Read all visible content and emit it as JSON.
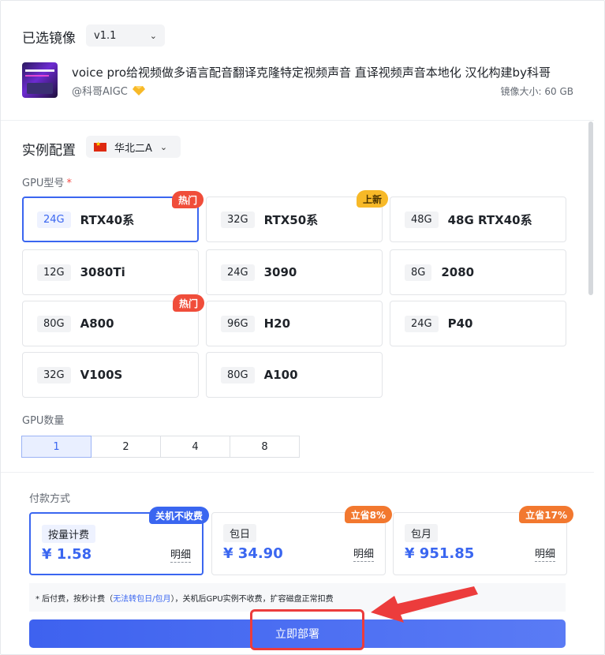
{
  "image_section": {
    "title": "已选镜像",
    "version": "v1.1",
    "image_title": "voice pro给视频做多语言配音翻译克隆特定视频声音 直译视频声音本地化 汉化构建by科哥",
    "author": "@科哥AIGC",
    "size": "镜像大小: 60 GB"
  },
  "config_section": {
    "title": "实例配置",
    "region": "华北二A",
    "gpu_model_label": "GPU型号",
    "required_mark": "*",
    "gpus": [
      {
        "mem": "24G",
        "name": "RTX40系",
        "badge": "热门"
      },
      {
        "mem": "32G",
        "name": "RTX50系",
        "badge": "上新"
      },
      {
        "mem": "48G",
        "name": "48G RTX40系",
        "badge": ""
      },
      {
        "mem": "12G",
        "name": "3080Ti",
        "badge": ""
      },
      {
        "mem": "24G",
        "name": "3090",
        "badge": ""
      },
      {
        "mem": "8G",
        "name": "2080",
        "badge": ""
      },
      {
        "mem": "80G",
        "name": "A800",
        "badge": "热门"
      },
      {
        "mem": "96G",
        "name": "H20",
        "badge": ""
      },
      {
        "mem": "24G",
        "name": "P40",
        "badge": ""
      },
      {
        "mem": "32G",
        "name": "V100S",
        "badge": ""
      },
      {
        "mem": "80G",
        "name": "A100",
        "badge": ""
      }
    ],
    "gpu_count_label": "GPU数量",
    "gpu_counts": [
      "1",
      "2",
      "4",
      "8"
    ]
  },
  "payment_section": {
    "title": "付款方式",
    "options": [
      {
        "mode": "按量计费",
        "price": "¥ 1.58",
        "detail": "明细",
        "badge": "关机不收费"
      },
      {
        "mode": "包日",
        "price": "¥ 34.90",
        "detail": "明细",
        "badge": "立省8%"
      },
      {
        "mode": "包月",
        "price": "¥ 951.85",
        "detail": "明细",
        "badge": "立省17%"
      }
    ],
    "note_prefix": "* 后付费，按秒计费（",
    "note_highlight": "无法转包日/包月",
    "note_suffix": "），关机后GPU实例不收费，扩容磁盘正常扣费",
    "deploy_label": "立即部署"
  },
  "colors": {
    "accent": "#3a66f0",
    "hot_badge": "#f04d3a",
    "new_badge": "#f7b928",
    "saving_badge": "#f2782f",
    "annotation_red": "#ec3c3c"
  }
}
